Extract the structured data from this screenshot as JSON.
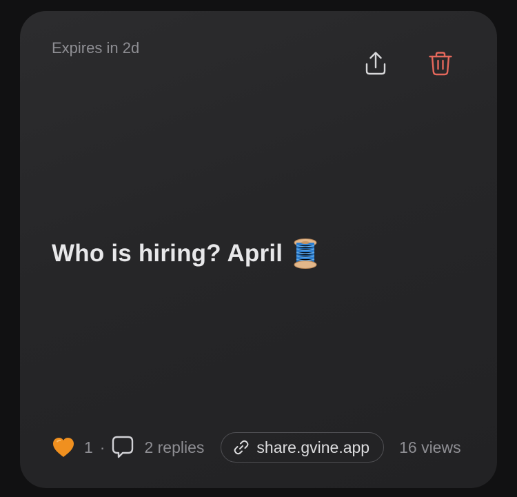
{
  "post": {
    "expires": "Expires in 2d",
    "title": "Who is hiring? April",
    "title_emoji_icon": "thread-spool-icon"
  },
  "actions": {
    "share_icon": "share-icon",
    "delete_icon": "trash-icon"
  },
  "footer": {
    "like_icon": "orange-heart-icon",
    "likes": "1",
    "separator": "·",
    "comment_icon": "comment-bubble-icon",
    "replies": "2 replies",
    "link_icon": "link-icon",
    "link": "share.gvine.app",
    "views": "16 views"
  },
  "colors": {
    "background": "#111112",
    "card": "#2a2a2c",
    "delete": "#e5685c",
    "heart": "#f0901f",
    "muted_text": "#8e8e93",
    "primary_text": "#e8e8ea"
  }
}
